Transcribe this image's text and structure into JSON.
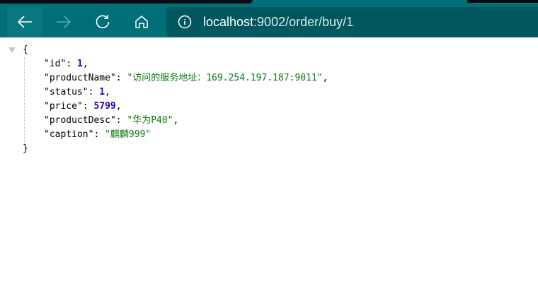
{
  "browser": {
    "url_host": "localhost",
    "url_rest": ":9002/order/buy/1",
    "icons": [
      "back-icon",
      "forward-icon",
      "reload-icon",
      "home-icon",
      "info-icon"
    ]
  },
  "json_rows": [
    {
      "key": "\"id\"",
      "value": "1",
      "type": "number",
      "comma": ","
    },
    {
      "key": "\"productName\"",
      "value": "\"访问的服务地址：169.254.197.187:9011\"",
      "type": "string",
      "comma": ","
    },
    {
      "key": "\"status\"",
      "value": "1",
      "type": "number",
      "comma": ","
    },
    {
      "key": "\"price\"",
      "value": "5799",
      "type": "number",
      "comma": ","
    },
    {
      "key": "\"productDesc\"",
      "value": "\"华为P40\"",
      "type": "string",
      "comma": ","
    },
    {
      "key": "\"caption\"",
      "value": "\"麒麟999\"",
      "type": "string",
      "comma": ""
    }
  ],
  "braces": {
    "open": "{",
    "close": "}"
  },
  "sep": ": "
}
